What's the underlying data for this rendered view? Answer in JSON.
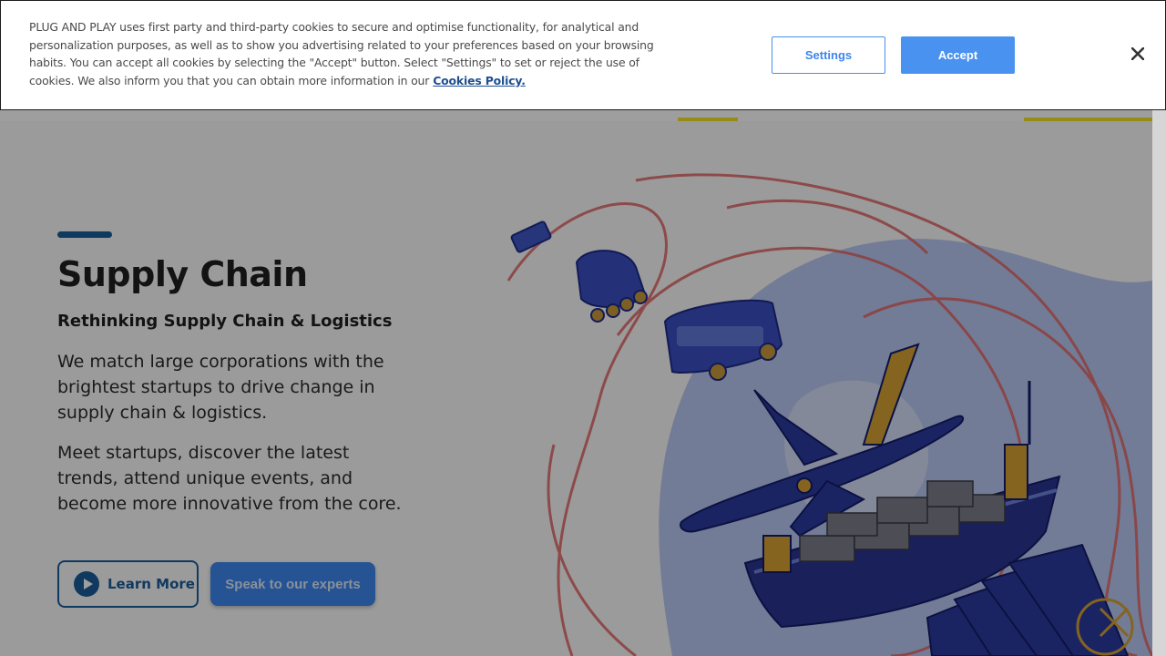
{
  "cookie_banner": {
    "text": "PLUG AND PLAY uses first party and third-party cookies to secure and optimise functionality, for analytical and personalization purposes, as well as to show you advertising related to your preferences based on your browsing habits. You can accept all cookies by selecting the \"Accept\" button. Select \"Settings\" to set or reject the use of cookies. We also inform you that you can obtain more information in our",
    "policy_link": "Cookies Policy.",
    "settings_label": "Settings",
    "accept_label": "Accept",
    "close_icon": "close-icon",
    "accent_color": "#4a92ef"
  },
  "hero": {
    "title": "Supply Chain",
    "subtitle": "Rethinking Supply Chain & Logistics",
    "paragraph1": "We match large corporations with the brightest startups to drive change in supply chain & logistics.",
    "paragraph2": "Meet startups, discover the latest trends, attend unique events, and become more innovative from the core.",
    "learn_more_label": "Learn More",
    "speak_label": "Speak to our experts",
    "play_icon": "play-icon",
    "brand_color": "#1b5d9a",
    "nav_accent_color": "#f2e021"
  }
}
